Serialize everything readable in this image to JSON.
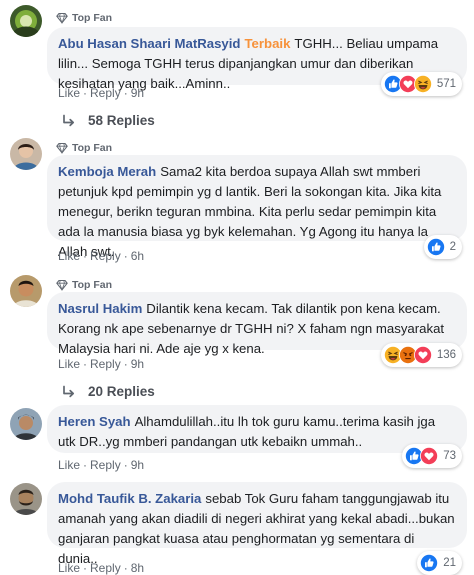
{
  "badge_label": "Top Fan",
  "actions": {
    "like": "Like",
    "reply": "Reply",
    "sep": "·"
  },
  "colors": {
    "author": "#385898",
    "badge": "#f7923b",
    "bubble": "#f2f3f5",
    "like": "#1877f2",
    "love": "#f33e58",
    "haha": "#f7b125"
  },
  "comments": [
    {
      "author": "Abu Hasan Shaari MatRasyid",
      "badge_text": "Terbaik",
      "text": "TGHH... Beliau umpama lilin... Semoga TGHH terus dipanjangkan umur dan diberikan kesihatan yang baik...Aminn..",
      "time": "9h",
      "reaction_icons": [
        "like-icon",
        "love-icon",
        "haha-icon"
      ],
      "reaction_count": "571",
      "replies": "58 Replies"
    },
    {
      "author": "Kemboja Merah",
      "text": "Sama2 kita berdoa supaya Allah swt mmberi petunjuk kpd pemimpin yg d lantik. Beri la sokongan kita. Jika kita menegur, berikn teguran mmbina. Kita perlu sedar pemimpin kita ada la manusia biasa yg byk kelemahan. Yg Agong itu hanya la Allah swt.",
      "time": "6h",
      "reaction_icons": [
        "like-icon"
      ],
      "reaction_count": "2"
    },
    {
      "author": "Nasrul Hakim",
      "text": "Dilantik kena kecam. Tak dilantik pon kena kecam. Korang nk ape sebenarnye dr TGHH ni? X faham ngn masyarakat Malaysia hari ni. Ade aje yg x kena.",
      "time": "9h",
      "reaction_icons": [
        "haha-icon",
        "angry-icon",
        "love-icon"
      ],
      "reaction_count": "136",
      "replies": "20 Replies"
    },
    {
      "author": "Heren Syah",
      "text": "Alhamdulillah..itu lh tok guru kamu..terima kasih jga utk DR..yg mmberi pandangan utk kebaikn ummah..",
      "time": "9h",
      "reaction_icons": [
        "like-icon",
        "love-icon"
      ],
      "reaction_count": "73"
    },
    {
      "author": "Mohd Taufik B. Zakaria",
      "text": "sebab Tok Guru faham tanggungjawab itu amanah yang akan diadili di negeri akhirat yang kekal abadi...bukan ganjaran pangkat kuasa atau penghormatan yg sementara di dunia..",
      "time": "8h",
      "reaction_icons": [
        "like-icon"
      ],
      "reaction_count": "21"
    }
  ]
}
